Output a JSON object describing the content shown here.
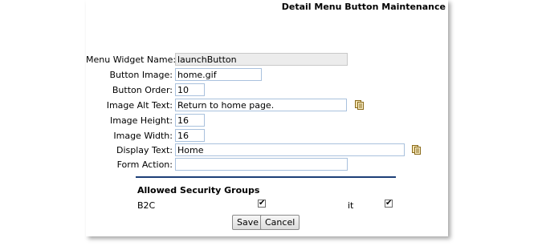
{
  "page_title": "Detail Menu Button Maintenance",
  "form": {
    "menu_widget_name": {
      "label": "Menu Widget Name:",
      "value": "launchButton"
    },
    "button_image": {
      "label": "Button Image:",
      "value": "home.gif"
    },
    "button_order": {
      "label": "Button Order:",
      "value": "10"
    },
    "image_alt_text": {
      "label": "Image Alt Text:",
      "value": "Return to home page."
    },
    "image_height": {
      "label": "Image Height:",
      "value": "16"
    },
    "image_width": {
      "label": "Image Width:",
      "value": "16"
    },
    "display_text": {
      "label": "Display Text:",
      "value": "Home"
    },
    "form_action": {
      "label": "Form Action:",
      "value": ""
    }
  },
  "security": {
    "title": "Allowed Security Groups",
    "groups": [
      {
        "name": "B2C",
        "checked": true
      },
      {
        "name": "it",
        "checked": true
      }
    ]
  },
  "buttons": {
    "save": "Save",
    "cancel": "Cancel"
  },
  "icons": {
    "lookup": "text-lookup-icon"
  },
  "colors": {
    "divider": "#1d3f77",
    "field_border": "#a9c1dd"
  }
}
